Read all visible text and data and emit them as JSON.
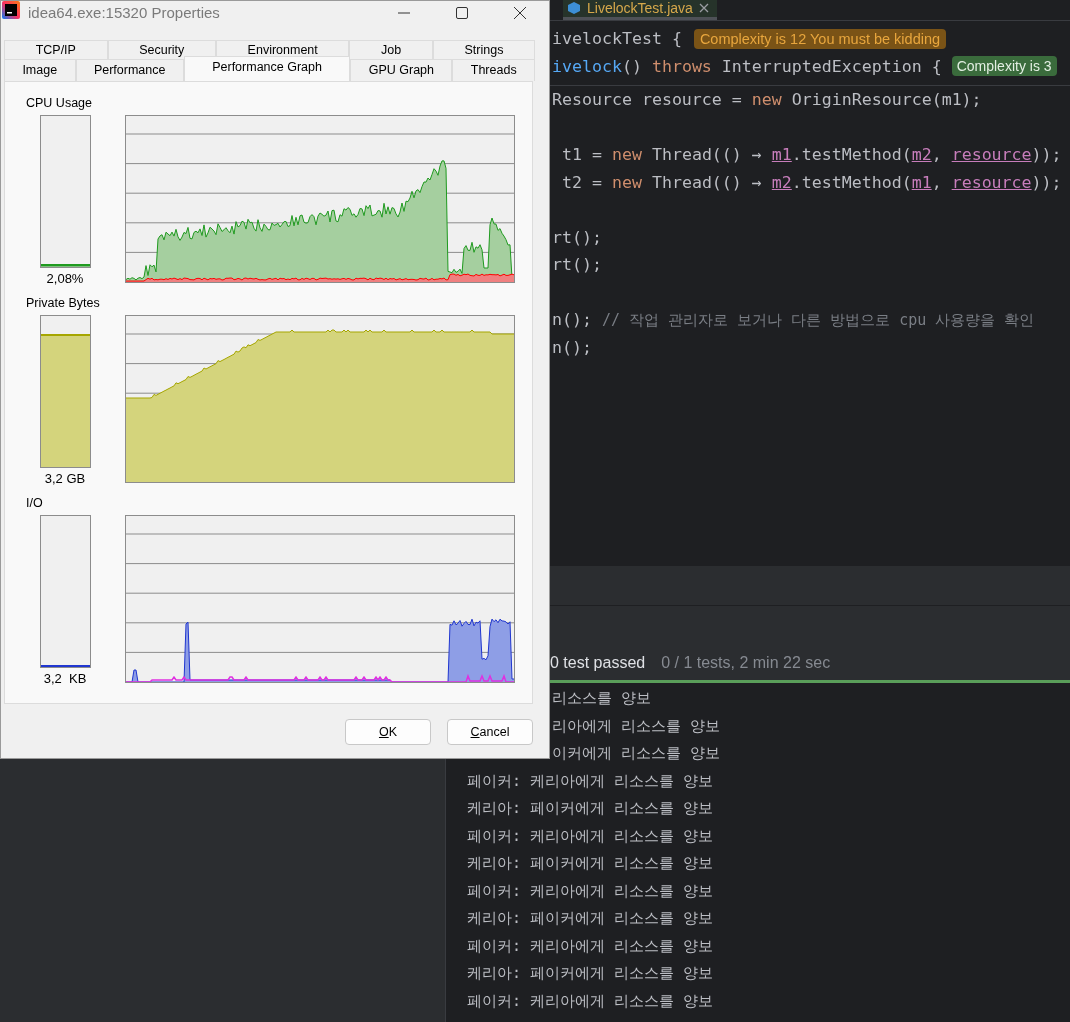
{
  "editor": {
    "tab": {
      "label": "LivelockTest.java",
      "selected": true
    },
    "lines": [
      {
        "kind": "code",
        "segments": [
          {
            "kind": "plain",
            "text": "ivelockTest {"
          }
        ],
        "badge": {
          "kind": "warning",
          "text": "Complexity is 12 You must be kidding"
        }
      },
      {
        "kind": "code",
        "segments": [
          {
            "kind": "method",
            "text": "ivelock"
          },
          {
            "kind": "plain",
            "text": "() "
          },
          {
            "kind": "keyword",
            "text": "throws"
          },
          {
            "kind": "plain",
            "text": " InterruptedException {"
          }
        ],
        "badge": {
          "kind": "ok",
          "text": "Complexity is 3"
        }
      },
      {
        "kind": "divider"
      },
      {
        "kind": "code",
        "segments": [
          {
            "kind": "plain",
            "text": "Resource resource = "
          },
          {
            "kind": "keyword",
            "text": "new"
          },
          {
            "kind": "plain",
            "text": " OriginResource(m1);"
          }
        ]
      },
      {
        "kind": "blank"
      },
      {
        "kind": "code",
        "segments": [
          {
            "kind": "plain",
            "text": " t1 = "
          },
          {
            "kind": "keyword",
            "text": "new"
          },
          {
            "kind": "plain",
            "text": " Thread(() → "
          },
          {
            "kind": "field",
            "text": "m1"
          },
          {
            "kind": "plain",
            "text": ".testMethod("
          },
          {
            "kind": "field",
            "text": "m2"
          },
          {
            "kind": "plain",
            "text": ", "
          },
          {
            "kind": "field",
            "text": "resource"
          },
          {
            "kind": "plain",
            "text": "));"
          }
        ]
      },
      {
        "kind": "code",
        "segments": [
          {
            "kind": "plain",
            "text": " t2 = "
          },
          {
            "kind": "keyword",
            "text": "new"
          },
          {
            "kind": "plain",
            "text": " Thread(() → "
          },
          {
            "kind": "field",
            "text": "m2"
          },
          {
            "kind": "plain",
            "text": ".testMethod("
          },
          {
            "kind": "field",
            "text": "m1"
          },
          {
            "kind": "plain",
            "text": ", "
          },
          {
            "kind": "field",
            "text": "resource"
          },
          {
            "kind": "plain",
            "text": "));"
          }
        ]
      },
      {
        "kind": "blank"
      },
      {
        "kind": "code",
        "segments": [
          {
            "kind": "plain",
            "text": "rt();"
          }
        ]
      },
      {
        "kind": "code",
        "segments": [
          {
            "kind": "plain",
            "text": "rt();"
          }
        ]
      },
      {
        "kind": "blank"
      },
      {
        "kind": "code",
        "segments": [
          {
            "kind": "plain",
            "text": "n(); "
          },
          {
            "kind": "comment",
            "text": "// 작업 관리자로 보거나 다른 방법으로 cpu 사용량을 확인"
          }
        ]
      },
      {
        "kind": "code",
        "segments": [
          {
            "kind": "plain",
            "text": "n();"
          }
        ]
      }
    ]
  },
  "test_status": {
    "result": "0 test passed",
    "summary": "0 / 1 tests, 2 min 22 sec"
  },
  "console": [
    {
      "kind": "partial",
      "text": "리소스를 양보"
    },
    {
      "kind": "partial",
      "text": "리아에게 리소스를 양보"
    },
    {
      "kind": "partial",
      "text": "이커에게 리소스를 양보"
    },
    {
      "kind": "full",
      "text": "페이커: 케리아에게 리소스를 양보"
    },
    {
      "kind": "full",
      "text": "케리아: 페이커에게 리소스를 양보"
    },
    {
      "kind": "full",
      "text": "페이커: 케리아에게 리소스를 양보"
    },
    {
      "kind": "full",
      "text": "케리아: 페이커에게 리소스를 양보"
    },
    {
      "kind": "full",
      "text": "페이커: 케리아에게 리소스를 양보"
    },
    {
      "kind": "full",
      "text": "케리아: 페이커에게 리소스를 양보"
    },
    {
      "kind": "full",
      "text": "페이커: 케리아에게 리소스를 양보"
    },
    {
      "kind": "full",
      "text": "케리아: 페이커에게 리소스를 양보"
    },
    {
      "kind": "full",
      "text": "페이커: 케리아에게 리소스를 양보"
    }
  ],
  "dialog": {
    "title": "idea64.exe:15320 Properties",
    "tab_rows": [
      [
        {
          "label": "TCP/IP",
          "selected": false
        },
        {
          "label": "Security",
          "selected": false
        },
        {
          "label": "Environment",
          "selected": false
        },
        {
          "label": "Job",
          "selected": false
        },
        {
          "label": "Strings",
          "selected": false
        }
      ],
      [
        {
          "label": "Image",
          "selected": false
        },
        {
          "label": "Performance",
          "selected": false
        },
        {
          "label": "Performance Graph",
          "selected": true
        },
        {
          "label": "GPU Graph",
          "selected": false
        },
        {
          "label": "Threads",
          "selected": false
        }
      ]
    ],
    "sections": [
      {
        "kind": "cpu",
        "label": "CPU Usage",
        "level": 0.02,
        "reading": "2,08%"
      },
      {
        "kind": "memory",
        "label": "Private Bytes",
        "level": 0.88,
        "reading": "3,2 GB"
      },
      {
        "kind": "io",
        "label": "I/O",
        "level": 0,
        "reading": "3,2  KB"
      }
    ],
    "buttons": [
      "OK",
      "Cancel"
    ]
  }
}
